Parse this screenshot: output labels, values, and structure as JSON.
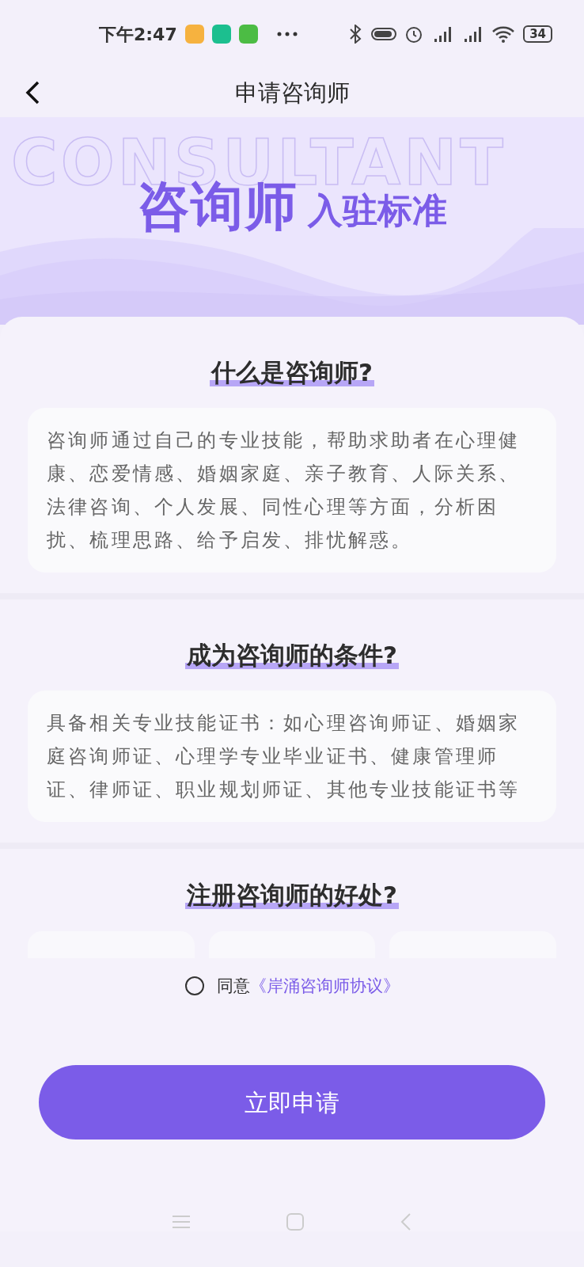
{
  "status_bar": {
    "time": "下午2:47",
    "battery": "34"
  },
  "header": {
    "title": "申请咨询师"
  },
  "banner": {
    "watermark": "CONSULTANT",
    "title_main": "咨询师",
    "title_sub": "入驻标准"
  },
  "sections": [
    {
      "title": "什么是咨询师?",
      "text": "咨询师通过自己的专业技能，帮助求助者在心理健康、恋爱情感、婚姻家庭、亲子教育、人际关系、法律咨询、个人发展、同性心理等方面，分析困扰、梳理思路、给予启发、排忧解惑。"
    },
    {
      "title": "成为咨询师的条件?",
      "text": "具备相关专业技能证书：如心理咨询师证、婚姻家庭咨询师证、心理学专业毕业证书、健康管理师证、律师证、职业规划师证、其他专业技能证书等"
    },
    {
      "title": "注册咨询师的好处?"
    }
  ],
  "agreement": {
    "checked": false,
    "label": "同意",
    "link": "《岸涌咨询师协议》"
  },
  "apply_button": "立即申请"
}
